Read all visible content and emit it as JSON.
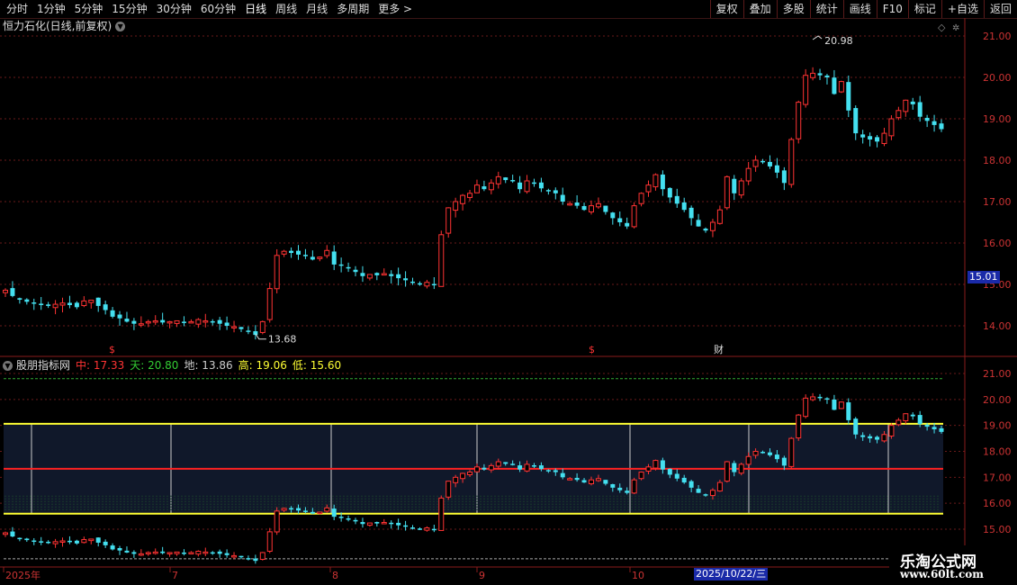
{
  "toolbar": {
    "periods": [
      "分时",
      "1分钟",
      "5分钟",
      "15分钟",
      "30分钟",
      "60分钟",
      "日线",
      "周线",
      "月线",
      "多周期",
      "更多 >"
    ],
    "active_period": "日线",
    "actions": [
      "复权",
      "叠加",
      "多股",
      "统计",
      "画线",
      "F10",
      "标记",
      "+自选",
      "返回"
    ]
  },
  "chart_title": "恒力石化(日线,前复权)",
  "indicator": {
    "name": "股朋指标网",
    "values": [
      {
        "label": "中:",
        "value": "17.33",
        "color": "#ff3333"
      },
      {
        "label": "天:",
        "value": "20.80",
        "color": "#33cc33"
      },
      {
        "label": "地:",
        "value": "13.86",
        "color": "#cccccc"
      },
      {
        "label": "高:",
        "value": "19.06",
        "color": "#ffff33"
      },
      {
        "label": "低:",
        "value": "15.60",
        "color": "#ffff33"
      }
    ]
  },
  "price_tag": "15.01",
  "date_tag": "2025/10/22/三",
  "watermark": {
    "line1": "乐淘公式网",
    "line2": "www.60lt.com"
  },
  "chart_data": {
    "type": "candlestick",
    "main_axis": {
      "ticks": [
        21.0,
        20.0,
        19.0,
        18.0,
        17.0,
        16.0,
        15.0,
        14.0
      ]
    },
    "sub_axis": {
      "ticks": [
        21.0,
        20.0,
        19.0,
        18.0,
        17.0,
        16.0,
        15.0
      ]
    },
    "annotations": [
      {
        "label": "20.98"
      },
      {
        "label": "13.68"
      }
    ],
    "markers": [
      "$",
      "$",
      "财"
    ],
    "x_labels": [
      "2025年",
      "7",
      "8",
      "9",
      "10"
    ],
    "levels": {
      "high": 19.06,
      "mid": 17.33,
      "low": 15.6,
      "sky": 20.8,
      "ground": 13.86
    },
    "closes": [
      14.86,
      14.72,
      14.63,
      14.58,
      14.54,
      14.5,
      14.48,
      14.52,
      14.55,
      14.5,
      14.45,
      14.6,
      14.62,
      14.48,
      14.38,
      14.22,
      14.18,
      14.1,
      14.05,
      14.05,
      14.1,
      14.12,
      14.08,
      14.1,
      14.12,
      14.08,
      14.1,
      14.15,
      14.12,
      14.08,
      14.05,
      14.0,
      13.98,
      13.92,
      13.86,
      13.78,
      14.1,
      14.9,
      15.7,
      15.8,
      15.76,
      15.72,
      15.7,
      15.6,
      15.66,
      15.82,
      15.48,
      15.46,
      15.4,
      15.3,
      15.2,
      15.24,
      15.22,
      15.26,
      15.2,
      15.15,
      15.1,
      15.05,
      15.0,
      15.05,
      15.0,
      16.2,
      16.85,
      17.0,
      17.15,
      17.2,
      17.4,
      17.3,
      17.45,
      17.6,
      17.52,
      17.5,
      17.3,
      17.5,
      17.45,
      17.32,
      17.25,
      17.2,
      17.0,
      16.95,
      16.9,
      16.8,
      16.9,
      16.95,
      16.75,
      16.6,
      16.5,
      16.4,
      16.9,
      17.2,
      17.4,
      17.65,
      17.3,
      17.1,
      16.95,
      16.8,
      16.6,
      16.4,
      16.3,
      16.5,
      16.8,
      17.6,
      17.2,
      17.5,
      17.8,
      18.0,
      17.95,
      17.85,
      17.7,
      17.45,
      18.5,
      19.4,
      20.05,
      20.1,
      20.05,
      20.0,
      19.6,
      19.9,
      19.2,
      18.65,
      18.55,
      18.5,
      18.45,
      18.65,
      19.0,
      19.2,
      19.45,
      19.35,
      19.05,
      18.95,
      18.85,
      18.75
    ]
  }
}
